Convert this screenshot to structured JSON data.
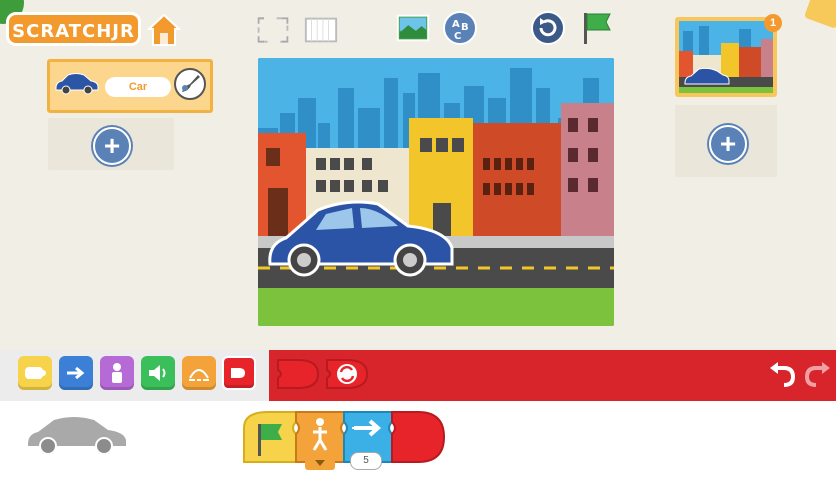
{
  "app": {
    "logo_text": "SCRATCHJR"
  },
  "header": {
    "home_icon": "home-icon",
    "fullscreen_icon": "fullscreen-icon",
    "grid_icon": "grid-icon",
    "background_icon": "background-icon",
    "text_icon": "text-abc-icon",
    "reset_icon": "reset-icon",
    "green_flag_icon": "green-flag-icon"
  },
  "sprites": {
    "items": [
      {
        "name": "Car"
      }
    ],
    "add_icon": "plus-icon"
  },
  "pages": {
    "items": [
      {
        "number": "1"
      }
    ],
    "add_icon": "plus-icon"
  },
  "palette": {
    "categories": [
      {
        "name": "triggering",
        "color": "#f6d34a"
      },
      {
        "name": "motion",
        "color": "#3b80d6"
      },
      {
        "name": "looks",
        "color": "#b56ad6"
      },
      {
        "name": "sound",
        "color": "#3bbf5b"
      },
      {
        "name": "control",
        "color": "#f3a33a"
      },
      {
        "name": "end",
        "color": "#e8242b"
      }
    ],
    "blocks": [
      "end-block",
      "repeat-forever-block"
    ],
    "undo_icon": "undo-icon",
    "redo_icon": "redo-icon"
  },
  "script": {
    "blocks": [
      "green-flag-start",
      "wait-for-message",
      "move-right",
      "end"
    ],
    "move_right_value": "5"
  },
  "colors": {
    "stage_bg": "#f1eee6",
    "palette_red": "#d8242b",
    "accent_orange": "#f39a2e",
    "plus_blue": "#5b82b6"
  }
}
